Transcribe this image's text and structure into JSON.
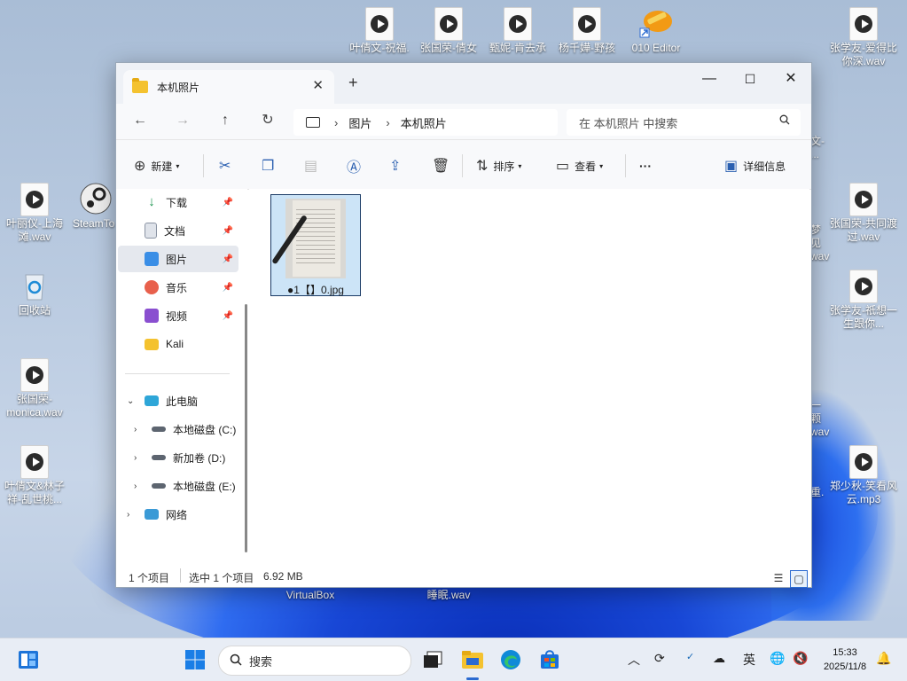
{
  "desktop": {
    "icons": [
      {
        "label": "叶倩文-祝福."
      },
      {
        "label": "张国荣-倩女"
      },
      {
        "label": "甄妮-肯去承"
      },
      {
        "label": "杨千嬅-野孩"
      },
      {
        "label": "010 Editor"
      },
      {
        "label": "张学友-爱得比你深.wav"
      },
      {
        "label": "叶丽仪-上海滩.wav"
      },
      {
        "label": "SteamTo"
      },
      {
        "label": "张国荣-共同渡过.wav"
      },
      {
        "label": "回收站"
      },
      {
        "label": "张学友-祇想一生跟你..."
      },
      {
        "label": "张国荣-monica.wav"
      },
      {
        "label": "叶倩文&林子祥-乱世桃..."
      },
      {
        "label": "郑少秋-笑看风云.mp3"
      },
      {
        "label": "VirtualBox"
      },
      {
        "label": "睡眠.wav"
      },
      {
        "label": "文-"
      },
      {
        "label": "..."
      },
      {
        "label": "梦见"
      },
      {
        "label": "wav"
      },
      {
        "label": "一颗"
      },
      {
        "label": "wav"
      },
      {
        "label": "重."
      }
    ]
  },
  "window": {
    "tab_title": "本机照片",
    "tab_close": "✕",
    "new_tab": "+",
    "controls": {
      "minimize": "—",
      "maximize": "☐",
      "close": "✕"
    },
    "nav": {
      "back": "←",
      "forward": "→",
      "up": "↑",
      "refresh": "↻"
    },
    "breadcrumb": {
      "sep": "›",
      "items": [
        "图片",
        "本机照片"
      ]
    },
    "search_placeholder": "在 本机照片 中搜索",
    "toolbar": {
      "new_label": "新建",
      "sort_label": "排序",
      "view_label": "查看",
      "more_label": "···",
      "details_label": "详细信息"
    },
    "sidebar": {
      "quick": [
        {
          "label": "下载",
          "pinned": true
        },
        {
          "label": "文档",
          "pinned": true
        },
        {
          "label": "图片",
          "pinned": true,
          "selected": true
        },
        {
          "label": "音乐",
          "pinned": true
        },
        {
          "label": "视频",
          "pinned": true
        },
        {
          "label": "Kali",
          "pinned": false
        }
      ],
      "this_pc": "此电脑",
      "drives": [
        "本地磁盘 (C:)",
        "新加卷 (D:)",
        "本地磁盘 (E:)"
      ],
      "network": "网络"
    },
    "files": [
      {
        "name": "●1【】0.jpg",
        "selected": true
      }
    ],
    "status": {
      "count": "1 个项目",
      "selection": "选中 1 个项目",
      "size": "6.92 MB"
    }
  },
  "taskbar": {
    "search_placeholder": "搜索",
    "tray": {
      "ime": "英"
    },
    "clock": {
      "time": "15:33",
      "date": "2025/11/8"
    }
  },
  "colors": {
    "accent": "#2b6ad0",
    "selection": "#cce4f7",
    "folder": "#f4c22f"
  }
}
